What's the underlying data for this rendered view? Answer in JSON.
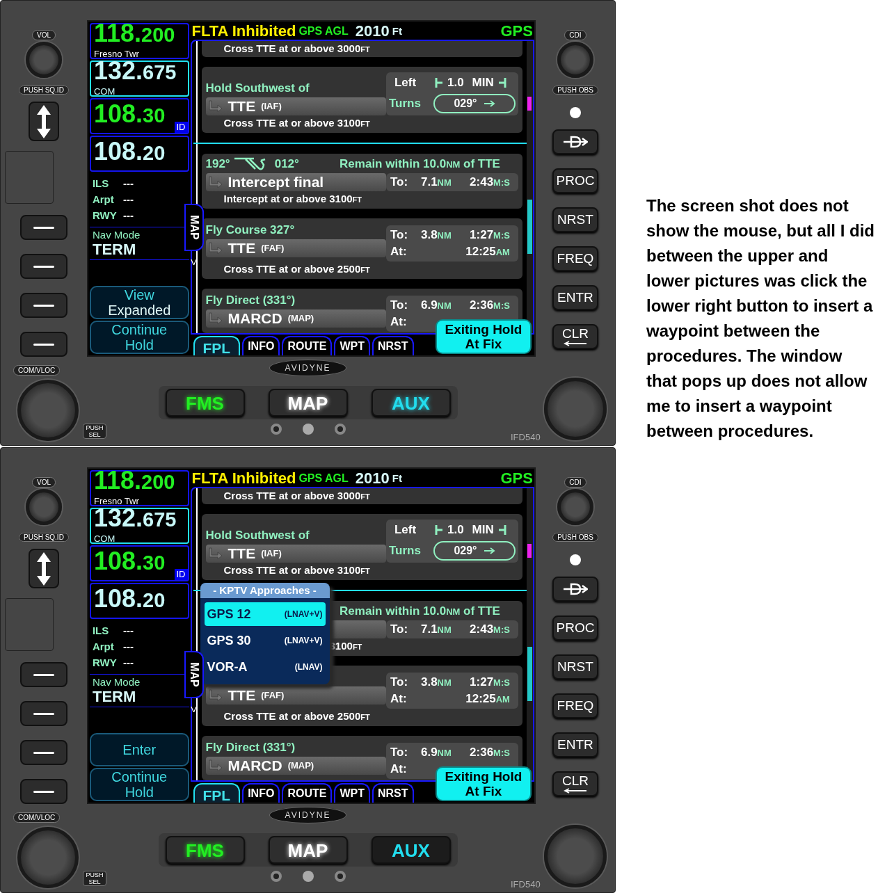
{
  "units": [
    {
      "bezel": {
        "vol": "VOL",
        "push_sq": "PUSH SQ.ID",
        "com_vloc": "COM/VLOC",
        "push_sel": "PUSH SEL",
        "cdi": "CDI",
        "push_obs": "PUSH OBS",
        "keys": [
          "PROC",
          "NRST",
          "FREQ",
          "ENTR"
        ],
        "clr": "CLR",
        "model": "IFD540",
        "brand": "AVIDYNE"
      },
      "header": {
        "alert": "FLTA Inhibited",
        "agl_label": "GPS AGL",
        "agl_value": "2010",
        "agl_unit": "Ft",
        "source": "GPS"
      },
      "freqs": [
        {
          "value": "118.200",
          "station": "Fresno Twr",
          "kind": "active",
          "selected": false
        },
        {
          "value": "132.675",
          "station": "COM",
          "kind": "standby",
          "selected": true
        },
        {
          "value": "108.30",
          "badge": "ID",
          "kind": "active",
          "selected": false
        },
        {
          "value": "108.20",
          "kind": "standby",
          "selected": false
        }
      ],
      "nav_info": [
        {
          "name": "ILS",
          "reading": "---"
        },
        {
          "name": "Arpt",
          "reading": "---"
        },
        {
          "name": "RWY",
          "reading": "---"
        }
      ],
      "nav_mode": {
        "label": "Nav Mode",
        "value": "TERM"
      },
      "soft_keys": [
        {
          "lines": [
            {
              "text": "View",
              "kind": "label"
            },
            {
              "text": "Expanded",
              "kind": "value"
            }
          ]
        },
        {
          "lines": [
            {
              "text": "Continue",
              "kind": "label"
            },
            {
              "text": "Hold",
              "kind": "label"
            }
          ]
        }
      ],
      "side_tab": {
        "label": "MAP",
        "chevron": ">"
      },
      "legs": [
        {
          "kind": "partial",
          "note": "Cross TTE at or above 3000",
          "note_unit": "FT"
        },
        {
          "kind": "hold",
          "title": "Hold Southwest of",
          "name": "TTE",
          "tag": "(IAF)",
          "turn_label": "Left",
          "leg_time": "1.0",
          "leg_unit": "MIN",
          "turns_label": "Turns",
          "course": "029°",
          "note": "Cross TTE at or above 3100",
          "note_unit": "FT"
        },
        {
          "kind": "insert_point"
        },
        {
          "kind": "intercept",
          "inbound": "192°",
          "outbound": "012°",
          "remain": "Remain within 10.0",
          "remain_unit": "NM",
          "remain_post": " of TTE",
          "name": "Intercept final",
          "to": {
            "label": "To:",
            "dist": "7.1",
            "dist_unit": "NM",
            "time": "2:43",
            "time_unit": "M:S"
          },
          "note": "Intercept at or above 3100",
          "note_unit": "FT",
          "covered": false
        },
        {
          "kind": "leg",
          "title": "Fly Course 327°",
          "name": "TTE",
          "tag": "(FAF)",
          "to": {
            "label": "To:",
            "dist": "3.8",
            "dist_unit": "NM",
            "time": "1:27",
            "time_unit": "M:S"
          },
          "at": {
            "label": "At:",
            "time": "12:25",
            "time_unit": "AM"
          },
          "note": "Cross TTE at or above 2500",
          "note_unit": "FT"
        },
        {
          "kind": "leg",
          "title": "Fly Direct (331°)",
          "name": "MARCD",
          "tag": "(MAP)",
          "to": {
            "label": "To:",
            "dist": "6.9",
            "dist_unit": "NM",
            "time": "2:36",
            "time_unit": "M:S"
          },
          "at": {
            "label": "At:"
          }
        }
      ],
      "action_button": [
        "Exiting Hold",
        "At Fix"
      ],
      "tabs": [
        {
          "label": "FPL",
          "selected": true
        },
        {
          "label": "INFO",
          "selected": false
        },
        {
          "label": "ROUTE",
          "selected": false
        },
        {
          "label": "WPT",
          "selected": false
        },
        {
          "label": "NRST",
          "selected": false
        }
      ],
      "mode_keys": [
        {
          "label": "FMS",
          "color": "#22ee22",
          "lit": true
        },
        {
          "label": "MAP",
          "color": "#ffffff",
          "lit": true
        },
        {
          "label": "AUX",
          "color": "#22ddee",
          "lit": true
        }
      ]
    },
    {
      "bezel": {
        "vol": "VOL",
        "push_sq": "PUSH SQ.ID",
        "com_vloc": "COM/VLOC",
        "push_sel": "PUSH SEL",
        "cdi": "CDI",
        "push_obs": "PUSH OBS",
        "keys": [
          "PROC",
          "NRST",
          "FREQ",
          "ENTR"
        ],
        "clr": "CLR",
        "model": "IFD540",
        "brand": "AVIDYNE"
      },
      "header": {
        "alert": "FLTA Inhibited",
        "agl_label": "GPS AGL",
        "agl_value": "2010",
        "agl_unit": "Ft",
        "source": "GPS"
      },
      "freqs": [
        {
          "value": "118.200",
          "station": "Fresno Twr",
          "kind": "active",
          "selected": false
        },
        {
          "value": "132.675",
          "station": "COM",
          "kind": "standby",
          "selected": true
        },
        {
          "value": "108.30",
          "badge": "ID",
          "kind": "active",
          "selected": false
        },
        {
          "value": "108.20",
          "kind": "standby",
          "selected": false
        }
      ],
      "nav_info": [
        {
          "name": "ILS",
          "reading": "---"
        },
        {
          "name": "Arpt",
          "reading": "---"
        },
        {
          "name": "RWY",
          "reading": "---"
        }
      ],
      "nav_mode": {
        "label": "Nav Mode",
        "value": "TERM"
      },
      "soft_keys": [
        {
          "lines": [
            {
              "text": "Enter",
              "kind": "label"
            }
          ]
        },
        {
          "lines": [
            {
              "text": "Continue",
              "kind": "label"
            },
            {
              "text": "Hold",
              "kind": "label"
            }
          ]
        }
      ],
      "side_tab": {
        "label": "MAP",
        "chevron": ">"
      },
      "legs": [
        {
          "kind": "partial",
          "note": "Cross TTE at or above 3000",
          "note_unit": "FT"
        },
        {
          "kind": "hold",
          "title": "Hold Southwest of",
          "name": "TTE",
          "tag": "(IAF)",
          "turn_label": "Left",
          "leg_time": "1.0",
          "leg_unit": "MIN",
          "turns_label": "Turns",
          "course": "029°",
          "note": "Cross TTE at or above 3100",
          "note_unit": "FT"
        },
        {
          "kind": "insert_point"
        },
        {
          "kind": "intercept",
          "remain": "Remain within 10.0",
          "remain_unit": "NM",
          "remain_post": " of TTE",
          "to": {
            "label": "To:",
            "dist": "7.1",
            "dist_unit": "NM",
            "time": "2:43",
            "time_unit": "M:S"
          },
          "note": "3100",
          "note_unit": "FT",
          "covered": true
        },
        {
          "kind": "leg",
          "name": "TTE",
          "tag": "(FAF)",
          "to": {
            "label": "To:",
            "dist": "3.8",
            "dist_unit": "NM",
            "time": "1:27",
            "time_unit": "M:S"
          },
          "at": {
            "label": "At:",
            "time": "12:25",
            "time_unit": "AM"
          },
          "note": "Cross TTE at or above 2500",
          "note_unit": "FT"
        },
        {
          "kind": "leg",
          "title": "Fly Direct (331°)",
          "name": "MARCD",
          "tag": "(MAP)",
          "to": {
            "label": "To:",
            "dist": "6.9",
            "dist_unit": "NM",
            "time": "2:36",
            "time_unit": "M:S"
          },
          "at": {
            "label": "At:"
          }
        }
      ],
      "popup": {
        "title": "- KPTV Approaches -",
        "items": [
          {
            "name": "GPS 12",
            "type": "(LNAV+V)",
            "selected": true
          },
          {
            "name": "GPS 30",
            "type": "(LNAV+V)",
            "selected": false
          },
          {
            "name": "VOR-A",
            "type": "(LNAV)",
            "selected": false
          }
        ]
      },
      "action_button": [
        "Exiting Hold",
        "At Fix"
      ],
      "tabs": [
        {
          "label": "FPL",
          "selected": true
        },
        {
          "label": "INFO",
          "selected": false
        },
        {
          "label": "ROUTE",
          "selected": false
        },
        {
          "label": "WPT",
          "selected": false
        },
        {
          "label": "NRST",
          "selected": false
        }
      ],
      "mode_keys": [
        {
          "label": "FMS",
          "color": "#22ee22",
          "lit": true
        },
        {
          "label": "MAP",
          "color": "#ffffff",
          "lit": true
        },
        {
          "label": "AUX",
          "color": "#22ddee",
          "lit": false
        }
      ]
    }
  ],
  "caption": "The screen shot does not show the mouse, but all I did between the upper and lower pictures was click the lower right button to insert a waypoint between the procedures.  The window that pops up does not allow me to insert a waypoint between procedures."
}
